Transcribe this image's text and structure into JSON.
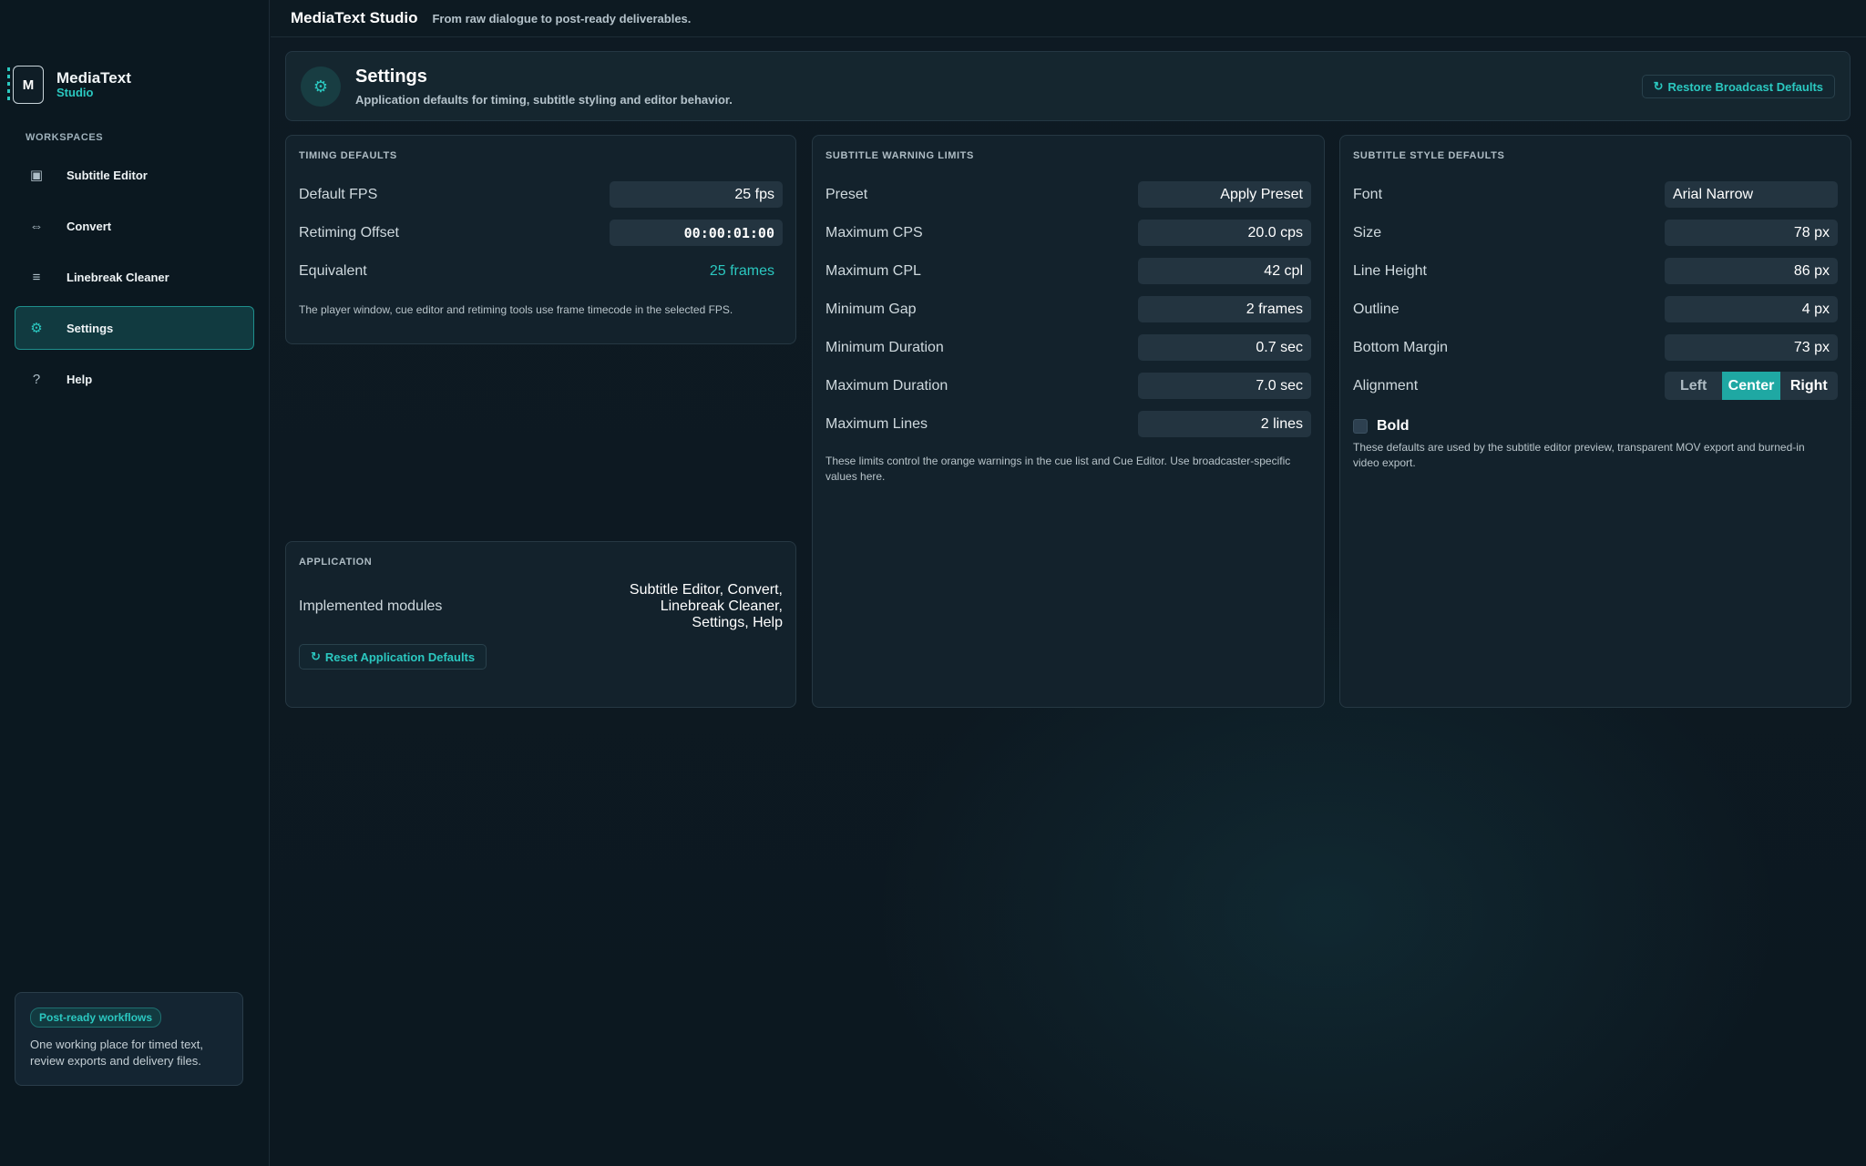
{
  "app": {
    "title": "MediaText Studio",
    "tagline": "From raw dialogue to post-ready deliverables."
  },
  "brand": {
    "logo_letter": "M",
    "name": "MediaText",
    "sub": "Studio"
  },
  "sidebar": {
    "heading": "WORKSPACES",
    "items": [
      {
        "label": "Subtitle Editor",
        "icon": "subtitle-editor-icon",
        "glyph": "▣"
      },
      {
        "label": "Convert",
        "icon": "convert-arrows-icon",
        "glyph": "⇔"
      },
      {
        "label": "Linebreak Cleaner",
        "icon": "lines-icon",
        "glyph": "≡"
      },
      {
        "label": "Settings",
        "icon": "gear-icon",
        "glyph": "⚙",
        "active": true
      },
      {
        "label": "Help",
        "icon": "question-icon",
        "glyph": "?"
      }
    ],
    "promo": {
      "badge": "Post-ready workflows",
      "text": "One working place for timed text, review exports and delivery files."
    }
  },
  "header": {
    "icon": "gear-icon",
    "title": "Settings",
    "description": "Application defaults for timing, subtitle styling and editor behavior.",
    "restore_button": "Restore Broadcast Defaults"
  },
  "timing": {
    "title": "TIMING DEFAULTS",
    "rows": [
      {
        "label": "Default FPS",
        "value": "25 fps"
      },
      {
        "label": "Retiming Offset",
        "value": "00:00:01:00"
      },
      {
        "label": "Equivalent",
        "value": "25 frames"
      }
    ],
    "note": "The player window, cue editor and retiming tools use frame timecode in the selected FPS."
  },
  "application": {
    "title": "APPLICATION",
    "modules_label": "Implemented modules",
    "modules_value": "Subtitle Editor, Convert, Linebreak Cleaner, Settings, Help",
    "reset_button": "Reset Application Defaults"
  },
  "warnings": {
    "title": "SUBTITLE WARNING LIMITS",
    "rows": [
      {
        "label": "Preset",
        "value": "Apply Preset"
      },
      {
        "label": "Maximum CPS",
        "value": "20.0 cps"
      },
      {
        "label": "Maximum CPL",
        "value": "42 cpl"
      },
      {
        "label": "Minimum Gap",
        "value": "2 frames"
      },
      {
        "label": "Minimum Duration",
        "value": "0.7 sec"
      },
      {
        "label": "Maximum Duration",
        "value": "7.0 sec"
      },
      {
        "label": "Maximum Lines",
        "value": "2 lines"
      }
    ],
    "note": "These limits control the orange warnings in the cue list and Cue Editor. Use broadcaster-specific values here."
  },
  "style": {
    "title": "SUBTITLE STYLE DEFAULTS",
    "rows": [
      {
        "label": "Font",
        "value": "Arial Narrow"
      },
      {
        "label": "Size",
        "value": "78 px"
      },
      {
        "label": "Line Height",
        "value": "86 px"
      },
      {
        "label": "Outline",
        "value": "4 px"
      },
      {
        "label": "Bottom Margin",
        "value": "73 px"
      }
    ],
    "alignment_label": "Alignment",
    "alignment_options": [
      "Left",
      "Center",
      "Right"
    ],
    "alignment_selected": "Center",
    "bold_label": "Bold",
    "bold_checked": false,
    "note": "These defaults are used by the subtitle editor preview, transparent MOV export and burned-in video export."
  },
  "colors": {
    "accent": "#2bc8c0",
    "background": "#0c1820",
    "panel": "#13222c",
    "field": "#233440",
    "active_nav": "#113a40"
  }
}
